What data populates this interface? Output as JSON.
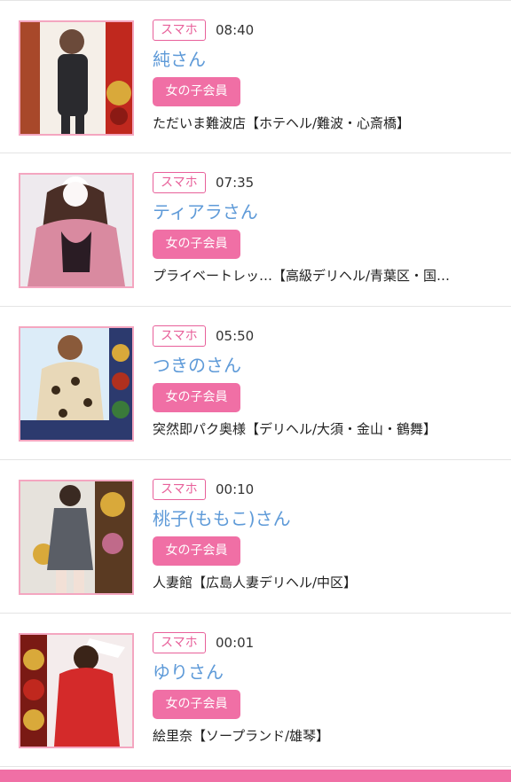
{
  "entries": [
    {
      "device": "スマホ",
      "time": "08:40",
      "name": "純さん",
      "badge": "女の子会員",
      "shop": "ただいま難波店【ホテヘル/難波・心斎橋】",
      "photo": "photo-woman-black-dress",
      "accent": "#c0281e"
    },
    {
      "device": "スマホ",
      "time": "07:35",
      "name": "ティアラさん",
      "badge": "女の子会員",
      "shop": "プライベートレッ…【高級デリヘル/青葉区・国…",
      "photo": "photo-woman-pink-cardigan",
      "accent": "#d9839e"
    },
    {
      "device": "スマホ",
      "time": "05:50",
      "name": "つきのさん",
      "badge": "女の子会員",
      "shop": "突然即パク奥様【デリヘル/大須・金山・鶴舞】",
      "photo": "photo-woman-leopard-dress",
      "accent": "#7fb2e0"
    },
    {
      "device": "スマホ",
      "time": "00:10",
      "name": "桃子(ももこ)さん",
      "badge": "女の子会員",
      "shop": "人妻館【広島人妻デリヘル/中区】",
      "photo": "photo-woman-grey-dress",
      "accent": "#b58a2c"
    },
    {
      "device": "スマホ",
      "time": "00:01",
      "name": "ゆりさん",
      "badge": "女の子会員",
      "shop": "絵里奈【ソープランド/雄琴】",
      "photo": "photo-woman-red-dress",
      "accent": "#d42a2a"
    }
  ],
  "colors": {
    "device_border": "#e8609a",
    "name_link": "#5e9ad8",
    "badge_bg": "#f06fa5",
    "thumb_border": "#f4a6c0"
  }
}
